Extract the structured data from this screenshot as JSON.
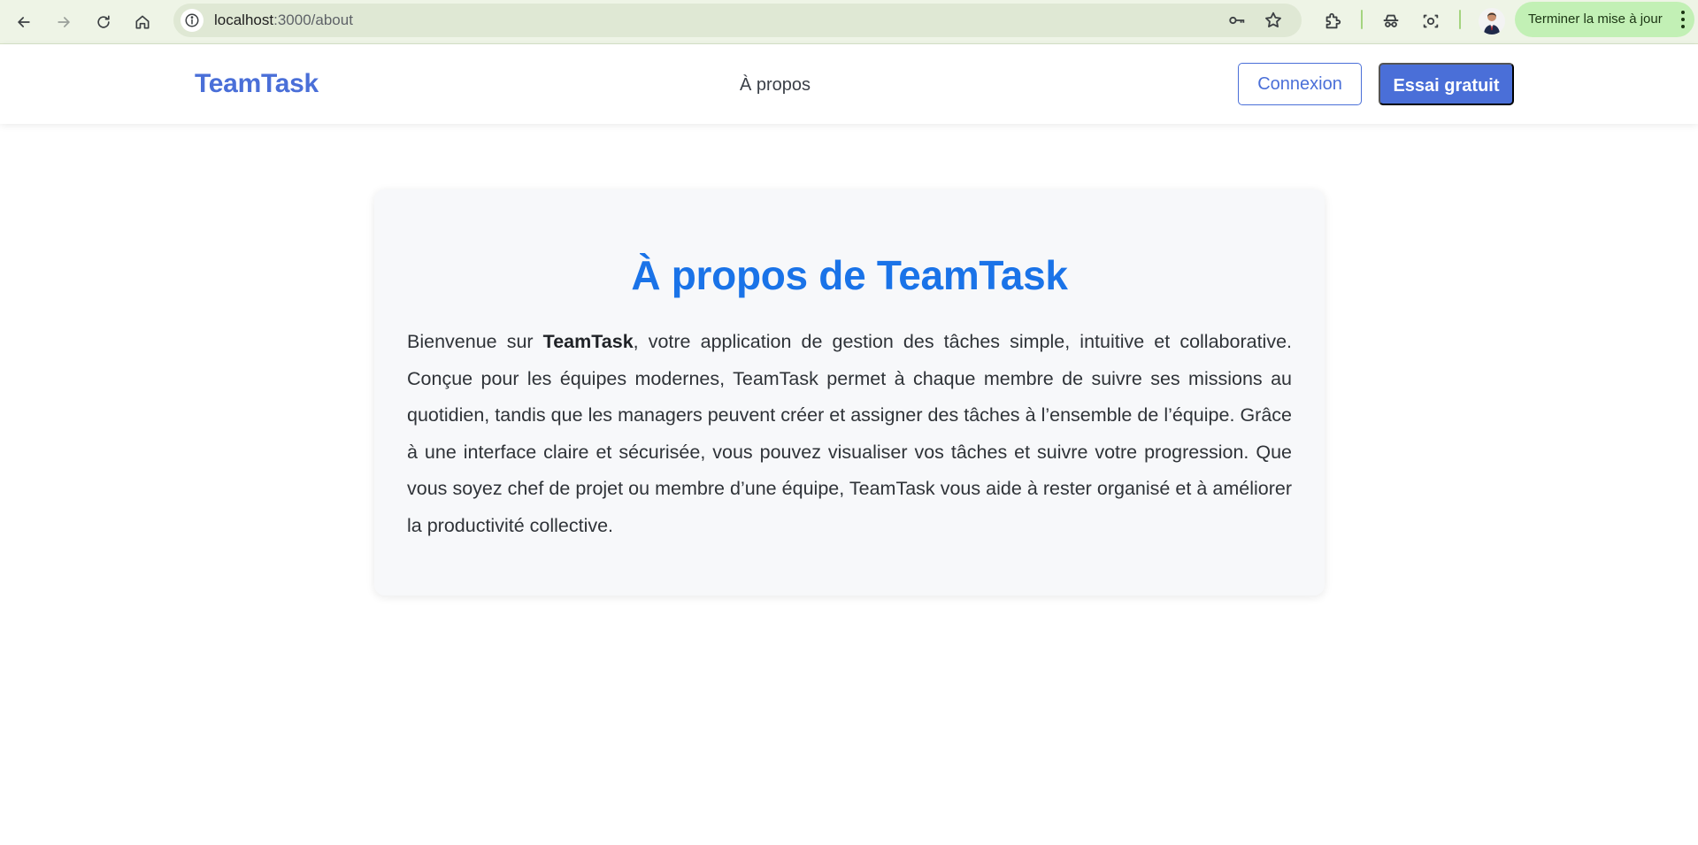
{
  "browser": {
    "url_host": "localhost",
    "url_port_path": ":3000/about",
    "update_button_label": "Terminer la mise à jour",
    "icons": {
      "back": "arrow-left-icon",
      "forward": "arrow-right-icon",
      "reload": "reload-icon",
      "home": "home-icon",
      "site_info": "info-icon",
      "password": "key-icon",
      "bookmark": "star-icon",
      "extensions": "puzzle-icon",
      "incognito": "spy-icon",
      "lens": "screenshot-icon",
      "menu": "kebab-menu-icon"
    },
    "colors": {
      "toolbar": "#eef4e6",
      "omnibox": "#dfe8d4",
      "update_button": "#c2f0b5"
    }
  },
  "site": {
    "logo": "TeamTask",
    "nav": {
      "about": "À propos"
    },
    "actions": {
      "login": "Connexion",
      "trial": "Essai gratuit"
    },
    "colors": {
      "brand": "#4a6fd8",
      "title": "#1a73e8",
      "card_bg": "#f7f8fa"
    }
  },
  "about": {
    "title": "À propos de TeamTask",
    "intro_before": "Bienvenue sur ",
    "intro_bold": "TeamTask",
    "intro_after": ", votre application de gestion des tâches simple, intuitive et collaborative. Conçue pour les équipes modernes, TeamTask permet à chaque membre de suivre ses missions au quotidien, tandis que les managers peuvent créer et assigner des tâches à l’ensemble de l’équipe. Grâce à une interface claire et sécurisée, vous pouvez visualiser vos tâches et suivre votre progression. Que vous soyez chef de projet ou membre d’une équipe, TeamTask vous aide à rester organisé et à améliorer la productivité collective."
  }
}
